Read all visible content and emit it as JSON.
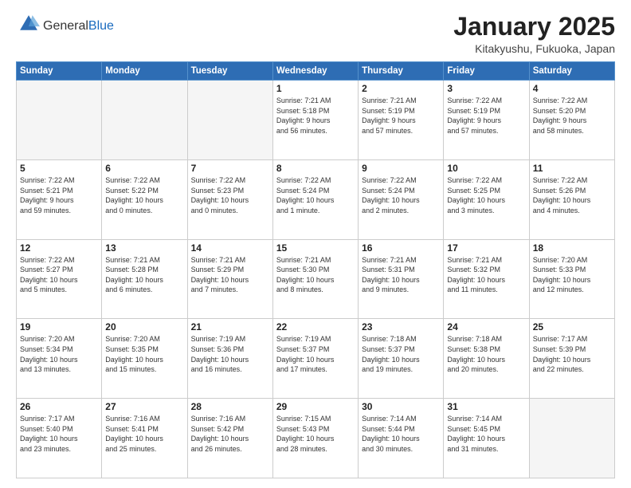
{
  "logo": {
    "general": "General",
    "blue": "Blue"
  },
  "header": {
    "month": "January 2025",
    "location": "Kitakyushu, Fukuoka, Japan"
  },
  "days_of_week": [
    "Sunday",
    "Monday",
    "Tuesday",
    "Wednesday",
    "Thursday",
    "Friday",
    "Saturday"
  ],
  "weeks": [
    [
      {
        "day": "",
        "info": ""
      },
      {
        "day": "",
        "info": ""
      },
      {
        "day": "",
        "info": ""
      },
      {
        "day": "1",
        "info": "Sunrise: 7:21 AM\nSunset: 5:18 PM\nDaylight: 9 hours\nand 56 minutes."
      },
      {
        "day": "2",
        "info": "Sunrise: 7:21 AM\nSunset: 5:19 PM\nDaylight: 9 hours\nand 57 minutes."
      },
      {
        "day": "3",
        "info": "Sunrise: 7:22 AM\nSunset: 5:19 PM\nDaylight: 9 hours\nand 57 minutes."
      },
      {
        "day": "4",
        "info": "Sunrise: 7:22 AM\nSunset: 5:20 PM\nDaylight: 9 hours\nand 58 minutes."
      }
    ],
    [
      {
        "day": "5",
        "info": "Sunrise: 7:22 AM\nSunset: 5:21 PM\nDaylight: 9 hours\nand 59 minutes."
      },
      {
        "day": "6",
        "info": "Sunrise: 7:22 AM\nSunset: 5:22 PM\nDaylight: 10 hours\nand 0 minutes."
      },
      {
        "day": "7",
        "info": "Sunrise: 7:22 AM\nSunset: 5:23 PM\nDaylight: 10 hours\nand 0 minutes."
      },
      {
        "day": "8",
        "info": "Sunrise: 7:22 AM\nSunset: 5:24 PM\nDaylight: 10 hours\nand 1 minute."
      },
      {
        "day": "9",
        "info": "Sunrise: 7:22 AM\nSunset: 5:24 PM\nDaylight: 10 hours\nand 2 minutes."
      },
      {
        "day": "10",
        "info": "Sunrise: 7:22 AM\nSunset: 5:25 PM\nDaylight: 10 hours\nand 3 minutes."
      },
      {
        "day": "11",
        "info": "Sunrise: 7:22 AM\nSunset: 5:26 PM\nDaylight: 10 hours\nand 4 minutes."
      }
    ],
    [
      {
        "day": "12",
        "info": "Sunrise: 7:22 AM\nSunset: 5:27 PM\nDaylight: 10 hours\nand 5 minutes."
      },
      {
        "day": "13",
        "info": "Sunrise: 7:21 AM\nSunset: 5:28 PM\nDaylight: 10 hours\nand 6 minutes."
      },
      {
        "day": "14",
        "info": "Sunrise: 7:21 AM\nSunset: 5:29 PM\nDaylight: 10 hours\nand 7 minutes."
      },
      {
        "day": "15",
        "info": "Sunrise: 7:21 AM\nSunset: 5:30 PM\nDaylight: 10 hours\nand 8 minutes."
      },
      {
        "day": "16",
        "info": "Sunrise: 7:21 AM\nSunset: 5:31 PM\nDaylight: 10 hours\nand 9 minutes."
      },
      {
        "day": "17",
        "info": "Sunrise: 7:21 AM\nSunset: 5:32 PM\nDaylight: 10 hours\nand 11 minutes."
      },
      {
        "day": "18",
        "info": "Sunrise: 7:20 AM\nSunset: 5:33 PM\nDaylight: 10 hours\nand 12 minutes."
      }
    ],
    [
      {
        "day": "19",
        "info": "Sunrise: 7:20 AM\nSunset: 5:34 PM\nDaylight: 10 hours\nand 13 minutes."
      },
      {
        "day": "20",
        "info": "Sunrise: 7:20 AM\nSunset: 5:35 PM\nDaylight: 10 hours\nand 15 minutes."
      },
      {
        "day": "21",
        "info": "Sunrise: 7:19 AM\nSunset: 5:36 PM\nDaylight: 10 hours\nand 16 minutes."
      },
      {
        "day": "22",
        "info": "Sunrise: 7:19 AM\nSunset: 5:37 PM\nDaylight: 10 hours\nand 17 minutes."
      },
      {
        "day": "23",
        "info": "Sunrise: 7:18 AM\nSunset: 5:37 PM\nDaylight: 10 hours\nand 19 minutes."
      },
      {
        "day": "24",
        "info": "Sunrise: 7:18 AM\nSunset: 5:38 PM\nDaylight: 10 hours\nand 20 minutes."
      },
      {
        "day": "25",
        "info": "Sunrise: 7:17 AM\nSunset: 5:39 PM\nDaylight: 10 hours\nand 22 minutes."
      }
    ],
    [
      {
        "day": "26",
        "info": "Sunrise: 7:17 AM\nSunset: 5:40 PM\nDaylight: 10 hours\nand 23 minutes."
      },
      {
        "day": "27",
        "info": "Sunrise: 7:16 AM\nSunset: 5:41 PM\nDaylight: 10 hours\nand 25 minutes."
      },
      {
        "day": "28",
        "info": "Sunrise: 7:16 AM\nSunset: 5:42 PM\nDaylight: 10 hours\nand 26 minutes."
      },
      {
        "day": "29",
        "info": "Sunrise: 7:15 AM\nSunset: 5:43 PM\nDaylight: 10 hours\nand 28 minutes."
      },
      {
        "day": "30",
        "info": "Sunrise: 7:14 AM\nSunset: 5:44 PM\nDaylight: 10 hours\nand 30 minutes."
      },
      {
        "day": "31",
        "info": "Sunrise: 7:14 AM\nSunset: 5:45 PM\nDaylight: 10 hours\nand 31 minutes."
      },
      {
        "day": "",
        "info": ""
      }
    ]
  ]
}
